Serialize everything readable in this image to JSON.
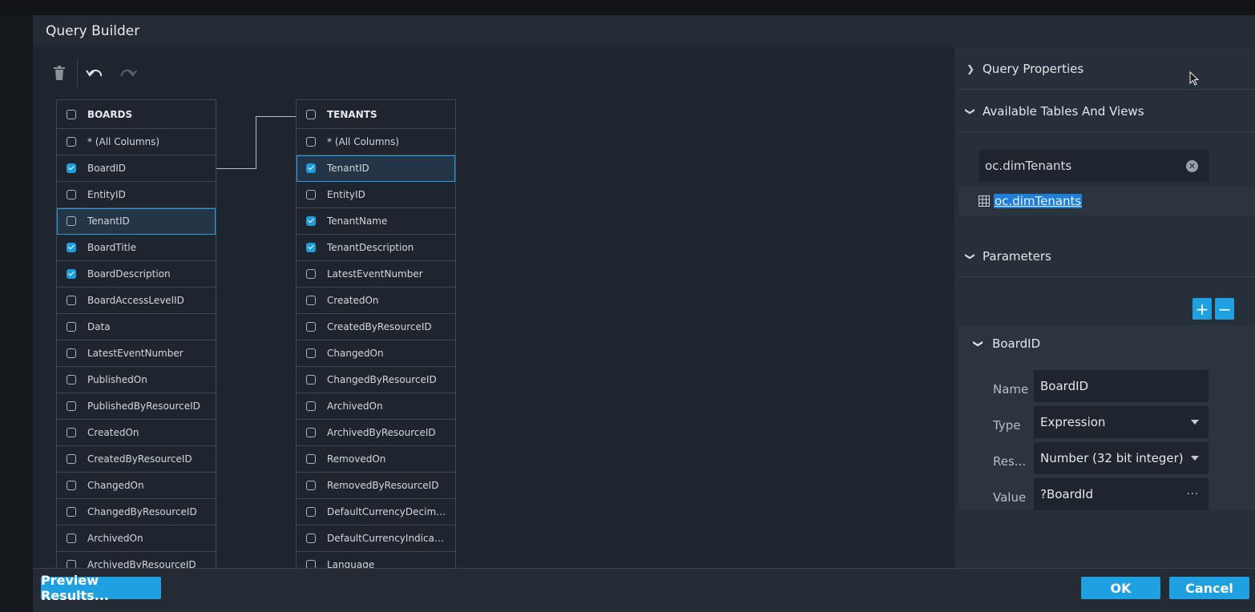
{
  "dialog": {
    "title": "Query Builder",
    "preview_label": "Preview Results...",
    "ok_label": "OK",
    "cancel_label": "Cancel"
  },
  "toolbar": {
    "delete_icon": "trash-icon",
    "undo_icon": "undo-icon",
    "redo_icon": "redo-icon"
  },
  "tables": [
    {
      "name": "BOARDS",
      "rows": [
        {
          "label": "* (All Columns)",
          "checked": false,
          "selected": false
        },
        {
          "label": "BoardID",
          "checked": true,
          "selected": false
        },
        {
          "label": "EntityID",
          "checked": false,
          "selected": false
        },
        {
          "label": "TenantID",
          "checked": false,
          "selected": true
        },
        {
          "label": "BoardTitle",
          "checked": true,
          "selected": false
        },
        {
          "label": "BoardDescription",
          "checked": true,
          "selected": false
        },
        {
          "label": "BoardAccessLevelID",
          "checked": false,
          "selected": false
        },
        {
          "label": "Data",
          "checked": false,
          "selected": false
        },
        {
          "label": "LatestEventNumber",
          "checked": false,
          "selected": false
        },
        {
          "label": "PublishedOn",
          "checked": false,
          "selected": false
        },
        {
          "label": "PublishedByResourceID",
          "checked": false,
          "selected": false
        },
        {
          "label": "CreatedOn",
          "checked": false,
          "selected": false
        },
        {
          "label": "CreatedByResourceID",
          "checked": false,
          "selected": false
        },
        {
          "label": "ChangedOn",
          "checked": false,
          "selected": false
        },
        {
          "label": "ChangedByResourceID",
          "checked": false,
          "selected": false
        },
        {
          "label": "ArchivedOn",
          "checked": false,
          "selected": false
        },
        {
          "label": "ArchivedByResourceID",
          "checked": false,
          "selected": false
        }
      ]
    },
    {
      "name": "TENANTS",
      "rows": [
        {
          "label": "* (All Columns)",
          "checked": false,
          "selected": false
        },
        {
          "label": "TenantID",
          "checked": true,
          "selected": true
        },
        {
          "label": "EntityID",
          "checked": false,
          "selected": false
        },
        {
          "label": "TenantName",
          "checked": true,
          "selected": false
        },
        {
          "label": "TenantDescription",
          "checked": true,
          "selected": false
        },
        {
          "label": "LatestEventNumber",
          "checked": false,
          "selected": false
        },
        {
          "label": "CreatedOn",
          "checked": false,
          "selected": false
        },
        {
          "label": "CreatedByResourceID",
          "checked": false,
          "selected": false
        },
        {
          "label": "ChangedOn",
          "checked": false,
          "selected": false
        },
        {
          "label": "ChangedByResourceID",
          "checked": false,
          "selected": false
        },
        {
          "label": "ArchivedOn",
          "checked": false,
          "selected": false
        },
        {
          "label": "ArchivedByResourceID",
          "checked": false,
          "selected": false
        },
        {
          "label": "RemovedOn",
          "checked": false,
          "selected": false
        },
        {
          "label": "RemovedByResourceID",
          "checked": false,
          "selected": false
        },
        {
          "label": "DefaultCurrencyDecimalDi...",
          "checked": false,
          "selected": false
        },
        {
          "label": "DefaultCurrencyIndicator",
          "checked": false,
          "selected": false
        },
        {
          "label": "Language",
          "checked": false,
          "selected": false
        }
      ]
    }
  ],
  "panel": {
    "query_properties": "Query Properties",
    "available_tables": "Available Tables And Views",
    "search_value": "oc.dimTenants",
    "result_item": "oc.dimTenants",
    "parameters": "Parameters",
    "param": {
      "title": "BoardID",
      "name_label": "Name",
      "name_value": "BoardID",
      "type_label": "Type",
      "type_value": "Expression",
      "result_label": "Res...",
      "result_value": "Number (32 bit integer)",
      "value_label": "Value",
      "value_value": "?BoardId",
      "dots": "···"
    },
    "add_symbol": "+",
    "remove_symbol": "−"
  }
}
